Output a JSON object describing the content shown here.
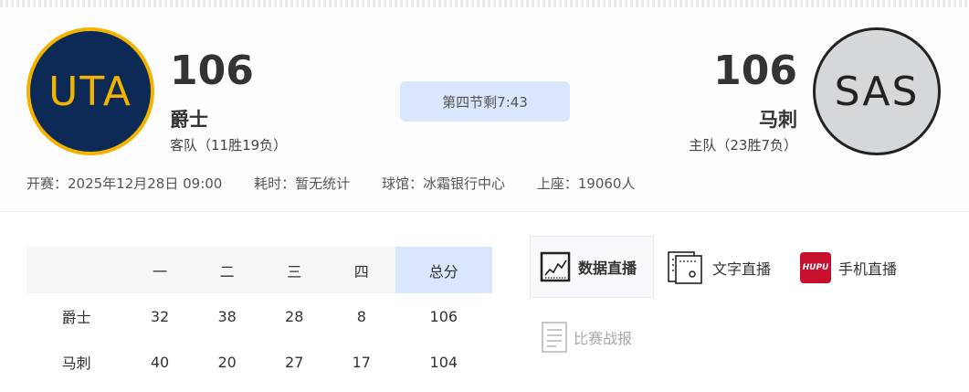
{
  "away": {
    "logo_text": "UTA",
    "logo_bg": "#0c2a55",
    "logo_accent": "#f2b400",
    "score": "106",
    "name": "爵士",
    "record": "客队（11胜19负）"
  },
  "home": {
    "logo_text": "SAS",
    "logo_bg": "#d4d8db",
    "logo_accent": "#222222",
    "score": "106",
    "name": "马刺",
    "record": "主队（23胜7负）"
  },
  "status": "第四节剩7:43",
  "meta": {
    "start": "开赛：2025年12月28日 09:00",
    "duration": "耗时：暂无统计",
    "venue": "球馆：冰霜银行中心",
    "attendance": "上座：19060人"
  },
  "box": {
    "headers": [
      "",
      "一",
      "二",
      "三",
      "四",
      "总分"
    ],
    "rows": [
      {
        "team": "爵士",
        "q": [
          "32",
          "38",
          "28",
          "8"
        ],
        "total": "106"
      },
      {
        "team": "马刺",
        "q": [
          "40",
          "20",
          "27",
          "17"
        ],
        "total": "104"
      }
    ]
  },
  "tabs": {
    "data_live": {
      "label": "数据直播",
      "icon": "chart-icon"
    },
    "text_live": {
      "label": "文字直播",
      "icon": "document-icon"
    },
    "mobile_live": {
      "label": "手机直播",
      "icon": "hupu-logo",
      "logo_text": "HUPU"
    },
    "report": {
      "label": "比赛战报",
      "icon": "report-icon"
    }
  },
  "colors": {
    "accent_bg": "#dae6fb",
    "hupu_red": "#c8102e"
  }
}
